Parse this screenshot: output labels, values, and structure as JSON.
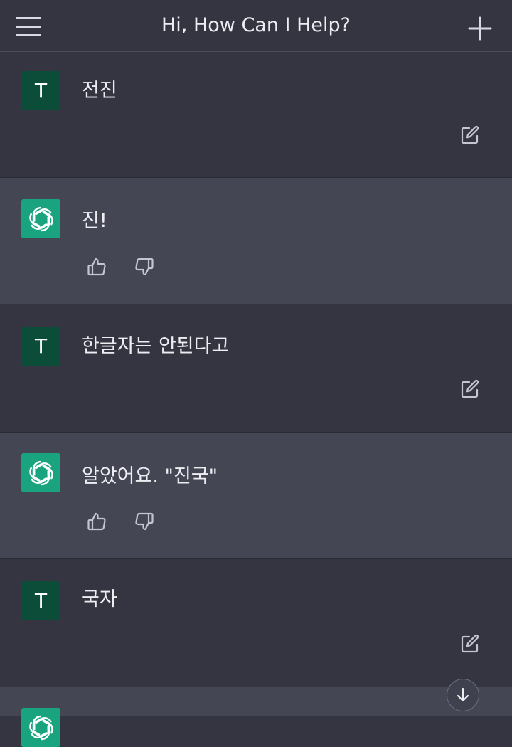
{
  "header": {
    "title": "Hi, How Can I Help?",
    "menu_icon": "hamburger-menu-icon",
    "new_chat_icon": "plus-icon"
  },
  "user_avatar_letter": "T",
  "colors": {
    "background": "#343541",
    "assistant_background": "#444654",
    "user_avatar": "#0b4d39",
    "assistant_avatar": "#19a37f",
    "text": "#ececf1"
  },
  "messages": [
    {
      "role": "user",
      "text": "전진"
    },
    {
      "role": "assistant",
      "text": "진!"
    },
    {
      "role": "user",
      "text": "한글자는 안된다고"
    },
    {
      "role": "assistant",
      "text": "알았어요. \"진국\""
    },
    {
      "role": "user",
      "text": "국자"
    },
    {
      "role": "assistant",
      "text": ""
    }
  ],
  "icons": {
    "edit": "edit-icon",
    "thumbs_up": "thumbs-up-icon",
    "thumbs_down": "thumbs-down-icon",
    "scroll_down": "arrow-down-icon",
    "assistant_logo": "openai-logo-icon"
  }
}
